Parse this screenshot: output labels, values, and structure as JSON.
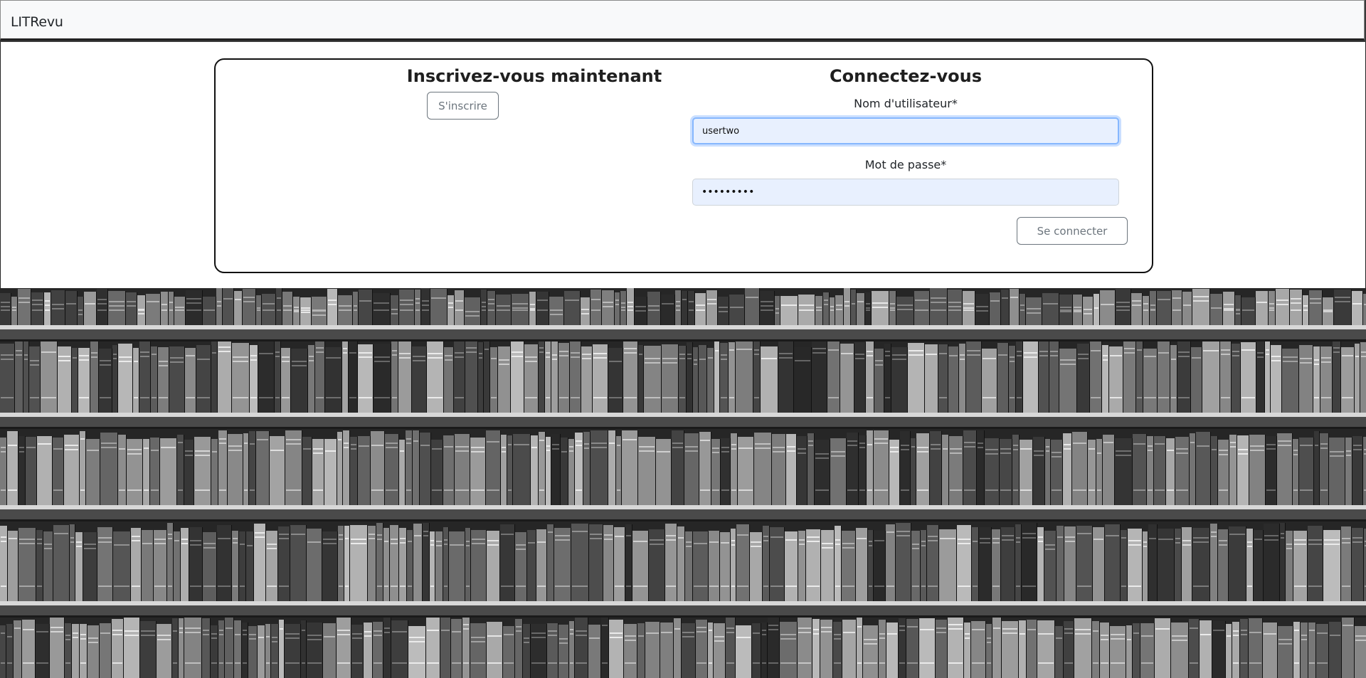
{
  "navbar": {
    "brand": "LITRevu"
  },
  "signup": {
    "title": "Inscrivez-vous maintenant",
    "button_label": "S'inscrire"
  },
  "login": {
    "title": "Connectez-vous",
    "username_label": "Nom d'utilisateur*",
    "username_value": "usertwo",
    "password_label": "Mot de passe*",
    "password_value": "•••••••••",
    "submit_label": "Se connecter"
  },
  "background": {
    "image": "bookshelf-photo",
    "style": "grayscale"
  },
  "colors": {
    "autofill_bg": "#e8f0fe",
    "focus_ring": "#86b7fe",
    "button_outline": "#6c757d",
    "navbar_bg": "#f8f9fa"
  }
}
